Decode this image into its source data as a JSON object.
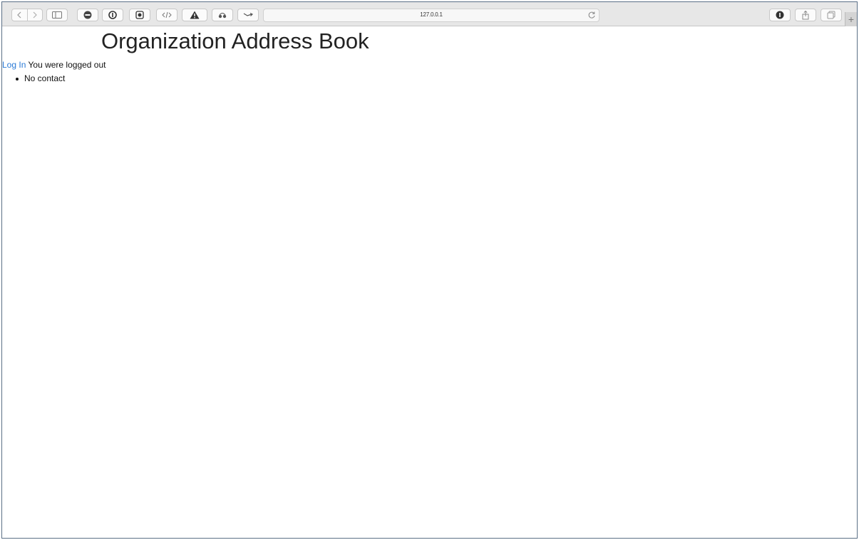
{
  "browser": {
    "address": "127.0.0.1",
    "icons": {
      "back": "chevron-left-icon",
      "forward": "chevron-right-icon",
      "sidebar": "sidebar-icon",
      "reload": "reload-icon",
      "info": "info-icon",
      "share": "share-icon",
      "tabs": "tabs-icon",
      "new_tab": "plus-icon"
    }
  },
  "page": {
    "title": "Organization Address Book",
    "login_link": "Log In",
    "status_message": "You were logged out",
    "contacts": [
      "No contact"
    ]
  },
  "colors": {
    "link": "#2a7ad6",
    "window_border": "#5b6f86",
    "toolbar_bg": "#e7e7e7"
  }
}
